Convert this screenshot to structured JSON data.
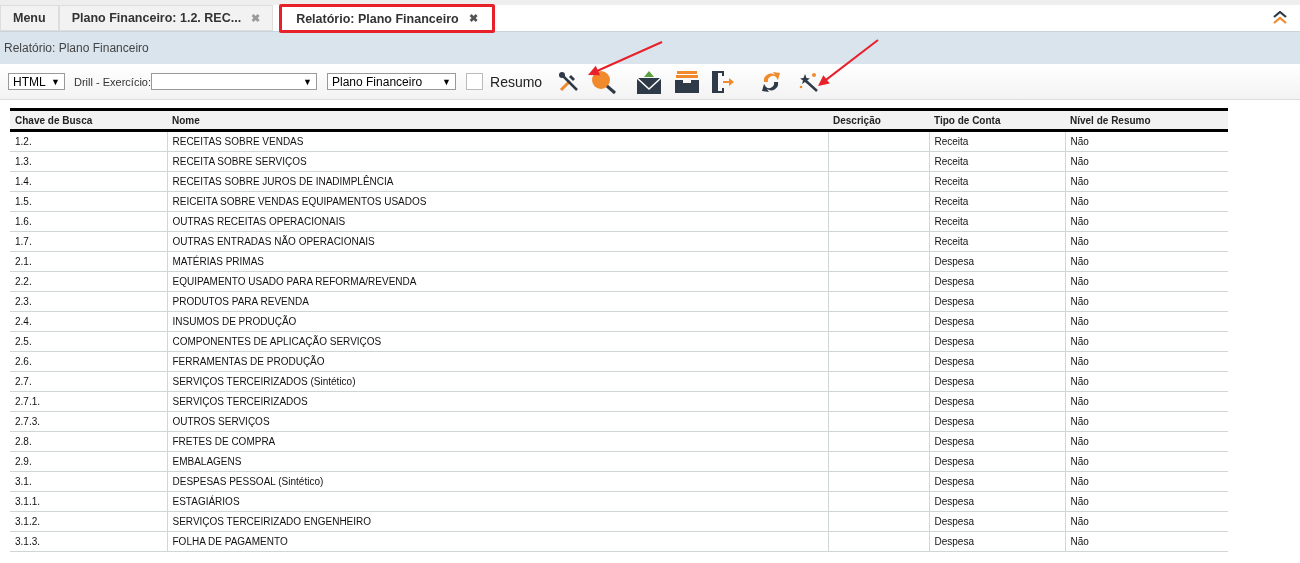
{
  "tabs": [
    {
      "label": "Menu",
      "selected": false,
      "closable": false,
      "highlighted": false
    },
    {
      "label": "Plano Financeiro: 1.2. REC...",
      "selected": false,
      "closable": true,
      "highlighted": false
    },
    {
      "label": "Relatório: Plano Financeiro",
      "selected": true,
      "closable": true,
      "highlighted": true
    }
  ],
  "close_glyph": "✖",
  "breadcrumb": "Relatório: Plano Financeiro",
  "toolbar": {
    "format": "HTML",
    "drill_label": "Drill - Exercício:",
    "report": "Plano Financeiro",
    "resumo_label": "Resumo",
    "resumo_checked": false,
    "dropdown_glyph": "▼"
  },
  "table": {
    "columns": [
      "Chave de Busca",
      "Nome",
      "Descrição",
      "Tipo de Conta",
      "Nível de Resumo"
    ],
    "rows": [
      [
        "1.2.",
        "RECEITAS SOBRE VENDAS",
        "",
        "Receita",
        "Não"
      ],
      [
        "1.3.",
        "RECEITA SOBRE SERVIÇOS",
        "",
        "Receita",
        "Não"
      ],
      [
        "1.4.",
        "RECEITAS SOBRE JUROS DE INADIMPLÊNCIA",
        "",
        "Receita",
        "Não"
      ],
      [
        "1.5.",
        "REICEITA SOBRE VENDAS EQUIPAMENTOS USADOS",
        "",
        "Receita",
        "Não"
      ],
      [
        "1.6.",
        "OUTRAS RECEITAS OPERACIONAIS",
        "",
        "Receita",
        "Não"
      ],
      [
        "1.7.",
        "OUTRAS ENTRADAS NÃO OPERACIONAIS",
        "",
        "Receita",
        "Não"
      ],
      [
        "2.1.",
        "MATÉRIAS PRIMAS",
        "",
        "Despesa",
        "Não"
      ],
      [
        "2.2.",
        "EQUIPAMENTO USADO PARA REFORMA/REVENDA",
        "",
        "Despesa",
        "Não"
      ],
      [
        "2.3.",
        "PRODUTOS PARA REVENDA",
        "",
        "Despesa",
        "Não"
      ],
      [
        "2.4.",
        "INSUMOS DE PRODUÇÃO",
        "",
        "Despesa",
        "Não"
      ],
      [
        "2.5.",
        "COMPONENTES DE APLICAÇÃO SERVIÇOS",
        "",
        "Despesa",
        "Não"
      ],
      [
        "2.6.",
        "FERRAMENTAS DE PRODUÇÃO",
        "",
        "Despesa",
        "Não"
      ],
      [
        "2.7.",
        "SERVIÇOS TERCEIRIZADOS (Sintético)",
        "",
        "Despesa",
        "Não"
      ],
      [
        "2.7.1.",
        "SERVIÇOS TERCEIRIZADOS",
        "",
        "Despesa",
        "Não"
      ],
      [
        "2.7.3.",
        "OUTROS SERVIÇOS",
        "",
        "Despesa",
        "Não"
      ],
      [
        "2.8.",
        "FRETES DE COMPRA",
        "",
        "Despesa",
        "Não"
      ],
      [
        "2.9.",
        "EMBALAGENS",
        "",
        "Despesa",
        "Não"
      ],
      [
        "3.1.",
        "DESPESAS PESSOAL (Sintético)",
        "",
        "Despesa",
        "Não"
      ],
      [
        "3.1.1.",
        "ESTAGIÁRIOS",
        "",
        "Despesa",
        "Não"
      ],
      [
        "3.1.2.",
        "SERVIÇOS TERCEIRIZADO ENGENHEIRO",
        "",
        "Despesa",
        "Não"
      ],
      [
        "3.1.3.",
        "FOLHA DE PAGAMENTO",
        "",
        "Despesa",
        "Não"
      ]
    ]
  }
}
